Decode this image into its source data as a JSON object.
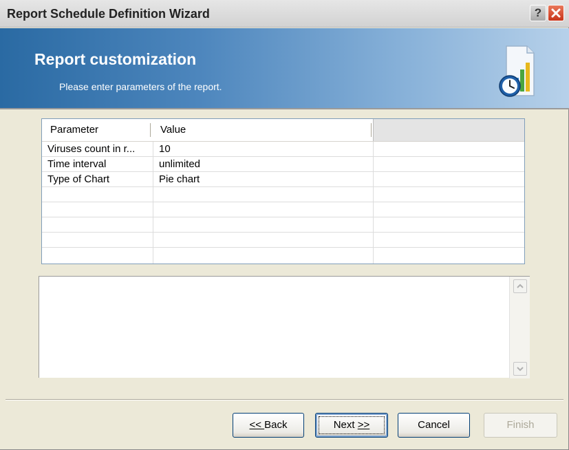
{
  "window": {
    "title": "Report Schedule Definition Wizard",
    "help_glyph": "?"
  },
  "banner": {
    "title": "Report customization",
    "subtitle": "Please enter parameters of the report.",
    "icon": "report-clock-chart-icon"
  },
  "grid": {
    "headers": [
      "Parameter",
      "Value"
    ],
    "rows": [
      {
        "parameter": "Viruses count in r...",
        "value": "10"
      },
      {
        "parameter": "Time interval",
        "value": "unlimited"
      },
      {
        "parameter": "Type of Chart",
        "value": "Pie chart"
      }
    ]
  },
  "buttons": {
    "back": {
      "prefix": "<< ",
      "label": "Back"
    },
    "next": {
      "label": "Next ",
      "suffix": ">>"
    },
    "cancel": "Cancel",
    "finish": "Finish"
  },
  "colors": {
    "banner_dark": "#2a6aa3",
    "banner_light": "#b7d1ea",
    "close": "#c8341a"
  }
}
